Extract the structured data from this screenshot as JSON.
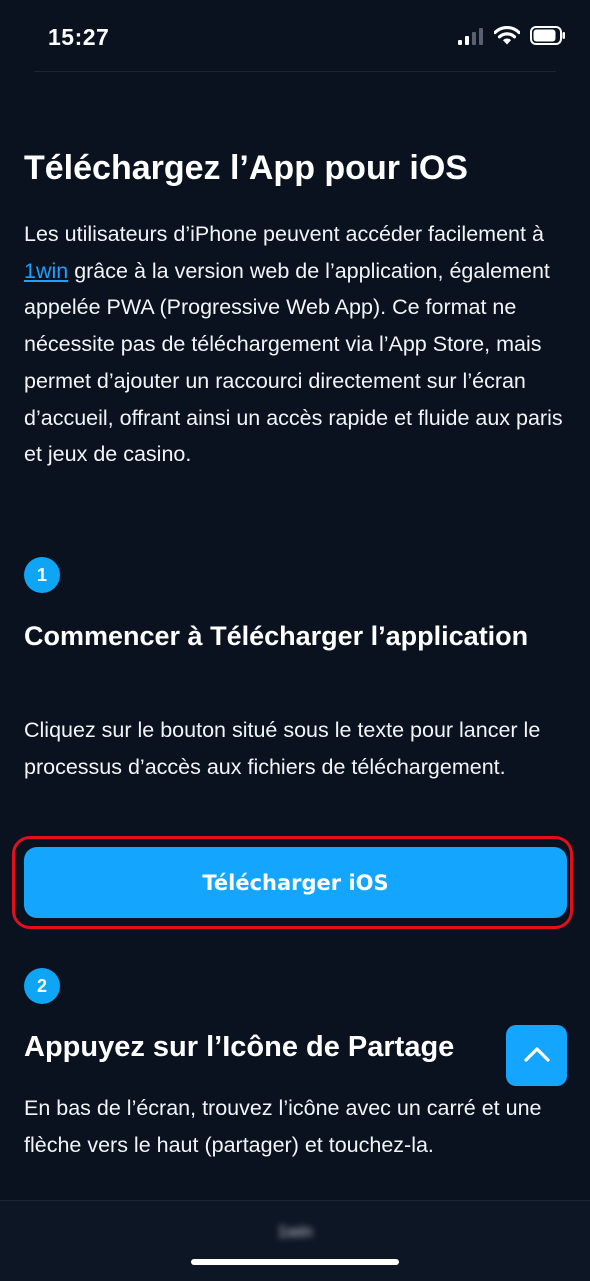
{
  "status_bar": {
    "time": "15:27",
    "icons": [
      "cellular-signal-icon",
      "wifi-icon",
      "battery-icon"
    ]
  },
  "page": {
    "title": "Téléchargez l’App pour iOS",
    "intro": {
      "before_link": "Les utilisateurs d’iPhone peuvent accéder facilement à ",
      "link_text": "1win",
      "after_link": " grâce à la version web de l’application, également appelée PWA (Progressive Web App). Ce format ne nécessite pas de téléchargement via l’App Store, mais permet d’ajouter un raccourci directement sur l’écran d’accueil, offrant ainsi un accès rapide et fluide aux paris et jeux de casino."
    }
  },
  "steps": [
    {
      "number": "1",
      "title": "Commencer à Télécharger l’application",
      "text": "Cliquez sur le bouton situé sous le texte pour lancer le processus d’accès aux fichiers de téléchargement."
    },
    {
      "number": "2",
      "title": "Appuyez sur l’Icône de Partage",
      "text": "En bas de l’écran, trouvez l’icône avec un carré et une flèche vers le haut (partager) et touchez-la."
    }
  ],
  "download_button": {
    "label": "Télécharger iOS"
  },
  "scroll_top": {
    "icon": "chevron-up-icon"
  },
  "bottom_bar": {
    "label": "1win"
  },
  "colors": {
    "background": "#0a1220",
    "accent": "#14a6ff",
    "link": "#1ea0ff",
    "highlight_border": "#e0101c"
  }
}
